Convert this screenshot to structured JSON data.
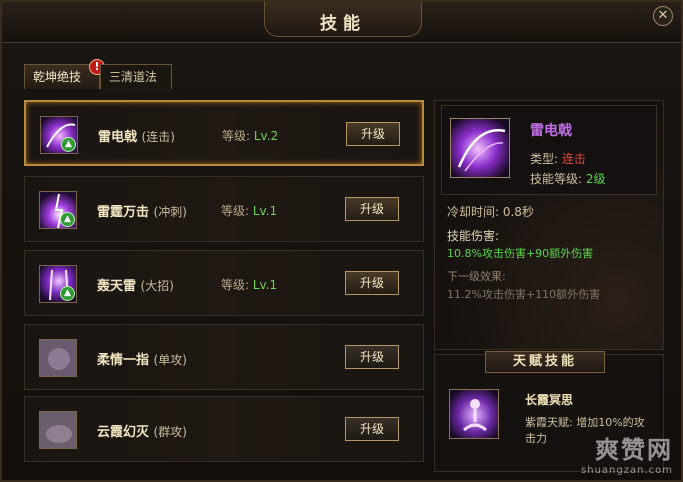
{
  "window": {
    "title": "技能"
  },
  "tabs": [
    {
      "label": "乾坤绝技",
      "badge": "!"
    },
    {
      "label": "三清道法"
    }
  ],
  "skills": [
    {
      "name": "雷电戟",
      "type": "(连击)",
      "level_label": "等级:",
      "level": "Lv.2",
      "button": "升级"
    },
    {
      "name": "雷霆万击",
      "type": "(冲刺)",
      "level_label": "等级:",
      "level": "Lv.1",
      "button": "升级"
    },
    {
      "name": "轰天雷",
      "type": "(大招)",
      "level_label": "等级:",
      "level": "Lv.1",
      "button": "升级"
    },
    {
      "name": "柔情一指",
      "type": "(单攻)",
      "button": "升级"
    },
    {
      "name": "云霞幻灭",
      "type": "(群攻)",
      "button": "升级"
    }
  ],
  "detail": {
    "name": "雷电戟",
    "type_label": "类型:",
    "type_value": "连击",
    "level_label": "技能等级:",
    "level_value": "2级",
    "cooldown": "冷却时间: 0.8秒",
    "damage_label": "技能伤害:",
    "damage_value": "10.8%攻击伤害+90额外伤害",
    "next_label": "下一级效果:",
    "next_value": "11.2%攻击伤害+110额外伤害"
  },
  "talent": {
    "title": "天赋技能",
    "name": "长霞冥思",
    "desc": "紫霞天赋: 增加10%的攻击力"
  },
  "watermark": {
    "big": "爽赞网",
    "small": "shuangzan.com"
  },
  "colors": {
    "accent": "#b88a3c",
    "skill_name_purple": "#c06ee8",
    "level_green": "#6ed34f",
    "type_red": "#e0473c"
  }
}
